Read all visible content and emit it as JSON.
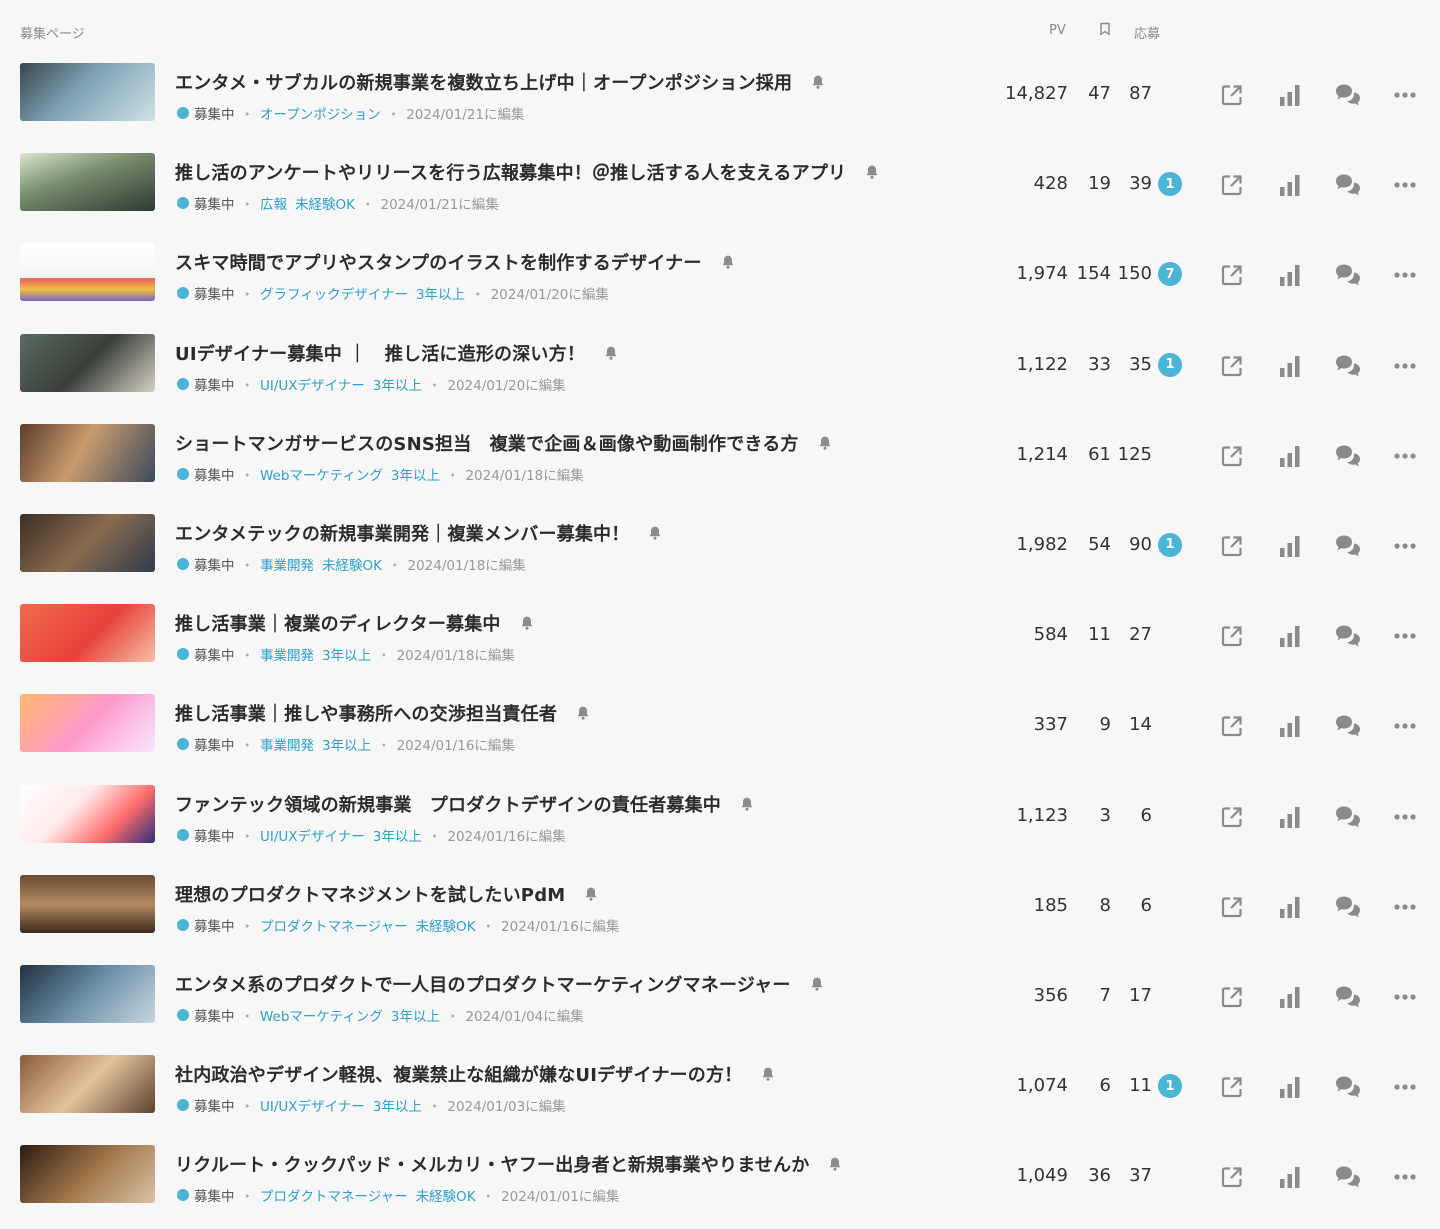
{
  "header": {
    "page_label": "募集ページ",
    "col_pv": "PV",
    "col_applied": "応募"
  },
  "icons": {
    "bookmark": "bookmark-icon",
    "bell": "bell-icon",
    "external": "external-link-icon",
    "stats": "bar-chart-icon",
    "chat": "chat-icon",
    "more": "more-icon"
  },
  "colors": {
    "accent": "#4ab5d6",
    "tag": "#2ea1cf"
  },
  "rows": [
    {
      "title": "エンタメ・サブカルの新規事業を複数立ち上げ中｜オープンポジション採用",
      "status": "募集中",
      "tags": [
        "オープンポジション"
      ],
      "edited": "2024/01/21に編集",
      "pv": "14,827",
      "bookmarks": "47",
      "applied": "87",
      "badge": ""
    },
    {
      "title": "推し活のアンケートやリリースを行う広報募集中！＠推し活する人を支えるアプリ",
      "status": "募集中",
      "tags": [
        "広報",
        "未経験OK"
      ],
      "edited": "2024/01/21に編集",
      "pv": "428",
      "bookmarks": "19",
      "applied": "39",
      "badge": "1"
    },
    {
      "title": "スキマ時間でアプリやスタンプのイラストを制作するデザイナー",
      "status": "募集中",
      "tags": [
        "グラフィックデザイナー",
        "3年以上"
      ],
      "edited": "2024/01/20に編集",
      "pv": "1,974",
      "bookmarks": "154",
      "applied": "150",
      "badge": "7"
    },
    {
      "title": "UIデザイナー募集中 ｜　推し活に造形の深い方！",
      "status": "募集中",
      "tags": [
        "UI/UXデザイナー",
        "3年以上"
      ],
      "edited": "2024/01/20に編集",
      "pv": "1,122",
      "bookmarks": "33",
      "applied": "35",
      "badge": "1"
    },
    {
      "title": "ショートマンガサービスのSNS担当　複業で企画＆画像や動画制作できる方",
      "status": "募集中",
      "tags": [
        "Webマーケティング",
        "3年以上"
      ],
      "edited": "2024/01/18に編集",
      "pv": "1,214",
      "bookmarks": "61",
      "applied": "125",
      "badge": ""
    },
    {
      "title": "エンタメテックの新規事業開発｜複業メンバー募集中！",
      "status": "募集中",
      "tags": [
        "事業開発",
        "未経験OK"
      ],
      "edited": "2024/01/18に編集",
      "pv": "1,982",
      "bookmarks": "54",
      "applied": "90",
      "badge": "1"
    },
    {
      "title": "推し活事業｜複業のディレクター募集中",
      "status": "募集中",
      "tags": [
        "事業開発",
        "3年以上"
      ],
      "edited": "2024/01/18に編集",
      "pv": "584",
      "bookmarks": "11",
      "applied": "27",
      "badge": ""
    },
    {
      "title": "推し活事業｜推しや事務所への交渉担当責任者",
      "status": "募集中",
      "tags": [
        "事業開発",
        "3年以上"
      ],
      "edited": "2024/01/16に編集",
      "pv": "337",
      "bookmarks": "9",
      "applied": "14",
      "badge": ""
    },
    {
      "title": "ファンテック領域の新規事業　プロダクトデザインの責任者募集中",
      "status": "募集中",
      "tags": [
        "UI/UXデザイナー",
        "3年以上"
      ],
      "edited": "2024/01/16に編集",
      "pv": "1,123",
      "bookmarks": "3",
      "applied": "6",
      "badge": ""
    },
    {
      "title": "理想のプロダクトマネジメントを試したいPdM",
      "status": "募集中",
      "tags": [
        "プロダクトマネージャー",
        "未経験OK"
      ],
      "edited": "2024/01/16に編集",
      "pv": "185",
      "bookmarks": "8",
      "applied": "6",
      "badge": ""
    },
    {
      "title": "エンタメ系のプロダクトで一人目のプロダクトマーケティングマネージャー",
      "status": "募集中",
      "tags": [
        "Webマーケティング",
        "3年以上"
      ],
      "edited": "2024/01/04に編集",
      "pv": "356",
      "bookmarks": "7",
      "applied": "17",
      "badge": ""
    },
    {
      "title": "社内政治やデザイン軽視、複業禁止な組織が嫌なUIデザイナーの方！",
      "status": "募集中",
      "tags": [
        "UI/UXデザイナー",
        "3年以上"
      ],
      "edited": "2024/01/03に編集",
      "pv": "1,074",
      "bookmarks": "6",
      "applied": "11",
      "badge": "1"
    },
    {
      "title": "リクルート・クックパッド・メルカリ・ヤフー出身者と新規事業やりませんか",
      "status": "募集中",
      "tags": [
        "プロダクトマネージャー",
        "未経験OK"
      ],
      "edited": "2024/01/01に編集",
      "pv": "1,049",
      "bookmarks": "36",
      "applied": "37",
      "badge": ""
    }
  ]
}
